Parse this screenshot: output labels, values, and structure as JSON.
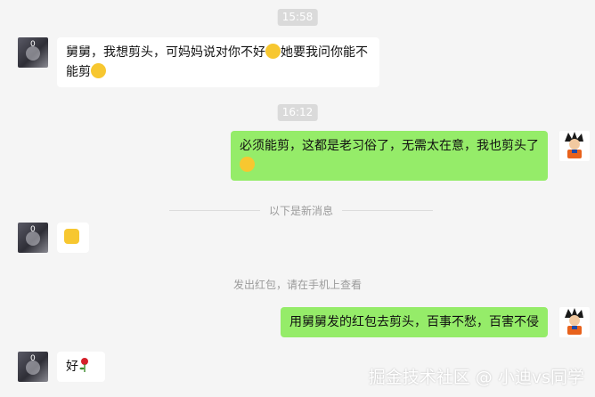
{
  "timestamps": [
    "15:58",
    "16:12"
  ],
  "messages": [
    {
      "text_a": "舅舅，我想剪头，可妈妈说对你不好",
      "emoji_a": "😅",
      "text_b": "她要我问你能不能剪",
      "emoji_b": "🙂"
    },
    {
      "text": "必须能剪，这都是老习俗了，无需太在意，我也剪头了",
      "emoji": "😁"
    },
    {
      "emoji": "👌"
    },
    {
      "text": "用舅舅发的红包去剪头，百事不愁，百害不侵"
    },
    {
      "text": "好",
      "emoji": "🌹"
    }
  ],
  "avatar_badge": "0",
  "divider_text": "以下是新消息",
  "system_notice": "发出红包，请在手机上查看",
  "watermark": "掘金技术社区 @ 小迪vs同学",
  "colors": {
    "background": "#f5f5f5",
    "incoming_bubble": "#ffffff",
    "outgoing_bubble": "#95ec69",
    "timestamp_bg": "#dadada"
  }
}
